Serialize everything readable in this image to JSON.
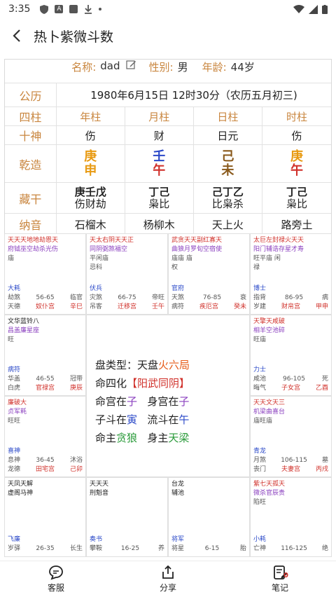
{
  "status": {
    "time": "3:35"
  },
  "header": {
    "title": "热卜紫微斗数"
  },
  "info": {
    "name_label": "名称:",
    "name": "dad",
    "gender_label": "性别:",
    "gender": "男",
    "age_label": "年龄:",
    "age": "44岁",
    "calendar_label": "公历",
    "calendar": "1980年6月15日 12时30分（农历五月初三)",
    "pillars_label": "四柱",
    "pillars": [
      "年柱",
      "月柱",
      "日柱",
      "时柱"
    ],
    "shishen_label": "十神",
    "shishen": [
      "伤",
      "财",
      "日元",
      "伤"
    ],
    "qianzao_label": "乾造",
    "gan": [
      "庚",
      "壬",
      "己",
      "庚"
    ],
    "zhi": [
      "申",
      "午",
      "未",
      "午"
    ],
    "canggan_label": "藏干",
    "cang_top": [
      "庚壬戊",
      "丁己",
      "己丁乙",
      "丁己"
    ],
    "cang_bot": [
      "伤财劫",
      "枭比",
      "比枭杀",
      "枭比"
    ],
    "nayin_label": "纳音",
    "nayin": [
      "石榴木",
      "杨柳木",
      "天上火",
      "路旁土"
    ],
    "colors": {
      "label": "#c9863f",
      "metal": "#e89a12",
      "water": "#2a48c8",
      "earth": "#8a5a1c",
      "fire": "#d0302a"
    }
  },
  "palaces": [
    {
      "stars1": "天天天地地劫恩天",
      "stars2": "府钺巫空劫杀光伤",
      "stars3": "庙",
      "god": "大耗",
      "a": "劫煞",
      "b": "56-65",
      "c": "临官",
      "d": "天德",
      "e": "奴仆宫",
      "f": "辛巳"
    },
    {
      "stars1": "天太右阴天天正",
      "stars2": "同阴弼煞福空",
      "stars3": "平闲庙",
      "stars4": "忌科",
      "god": "伏兵",
      "a": "灾煞",
      "b": "66-75",
      "c": "帝旺",
      "d": "吊客",
      "e": "迁移宫",
      "f": "壬午"
    },
    {
      "stars1": "武贪天天副红寡天",
      "stars2": "曲狼月罗旬空宿使",
      "stars3": "庙庙 庙",
      "stars4": "权",
      "god": "官府",
      "a": "天煞",
      "b": "76-85",
      "c": "衰",
      "d": "病符",
      "e": "疾厄宫",
      "f": "癸未"
    },
    {
      "stars1": "太巨左封禄火天天",
      "stars2": "阳门辅诰存星才寿",
      "stars3": "旺平庙 闲",
      "stars4": "禄",
      "god": "博士",
      "a": "指背",
      "b": "86-95",
      "c": "病",
      "d": "岁建",
      "e": "财帛宫",
      "f": "甲申"
    },
    {
      "stars1": "文华蓝铃八",
      "stars2": "昌盖廉星座",
      "stars3": "旺",
      "god": "病符",
      "a": "华盖",
      "b": "46-55",
      "c": "冠带",
      "d": "白虎",
      "e": "官禄宫",
      "f": "庚辰"
    },
    {
      "stars1": "天擎天咸破",
      "stars2": "相羊空池碎",
      "stars3": "旺庙",
      "god": "力士",
      "a": "咸池",
      "b": "96-105",
      "c": "死",
      "d": "晦气",
      "e": "子女宫",
      "f": "乙酉"
    },
    {
      "stars1": "廉破大",
      "stars2": "贞军耗",
      "stars3": "旺旺",
      "god": "喜神",
      "a": "息神",
      "b": "36-45",
      "c": "沐浴",
      "d": "龙德",
      "e": "田宅宫",
      "f": "己卯"
    },
    {
      "stars1": "天天文天三",
      "stars2": "机梁曲喜台",
      "stars3": "庙旺庙",
      "god": "青龙",
      "a": "月煞",
      "b": "106-115",
      "c": "墓",
      "d": "丧门",
      "e": "夫妻宫",
      "f": "丙戌"
    },
    {
      "stars1": "天凤天解",
      "stars2": "虚阁马神",
      "god": "飞廉",
      "a": "岁驿",
      "b": "26-35",
      "c": "长生"
    },
    {
      "stars1": "天天天",
      "stars2": "刑魁音",
      "god": "奏书",
      "a": "攀鞍",
      "b": "16-25",
      "c": "养"
    },
    {
      "stars1": "台龙",
      "stars2": "辅池",
      "god": "将军",
      "a": "将星",
      "b": "6-15",
      "c": "胎"
    },
    {
      "stars1": "紫七天孤天",
      "stars2": "微杀官辰贵",
      "stars3": "陷旺",
      "god": "小耗",
      "a": "亡神",
      "b": "116-125",
      "c": "绝"
    }
  ],
  "center": {
    "type_label": "盘类型：天盘",
    "type_value": "火六局",
    "sihua_label": "命四化",
    "sihua_value": "【阳武同阴】",
    "minggong_label": "命宫在",
    "minggong_value": "子",
    "shengong_label": "身宫在",
    "shengong_value": "子",
    "zidou_label": "子斗在",
    "zidou_value": "寅",
    "liunian_label": "流斗在",
    "liunian_value": "午",
    "mingzhu_label": "命主",
    "mingzhu_value": "贪狼",
    "shenzhu_label": "身主",
    "shenzhu_value": "天梁"
  },
  "nav": [
    {
      "label": "客服",
      "icon": "chat-icon"
    },
    {
      "label": "分享",
      "icon": "share-icon"
    },
    {
      "label": "笔记",
      "icon": "note-icon",
      "badge": "0"
    }
  ]
}
